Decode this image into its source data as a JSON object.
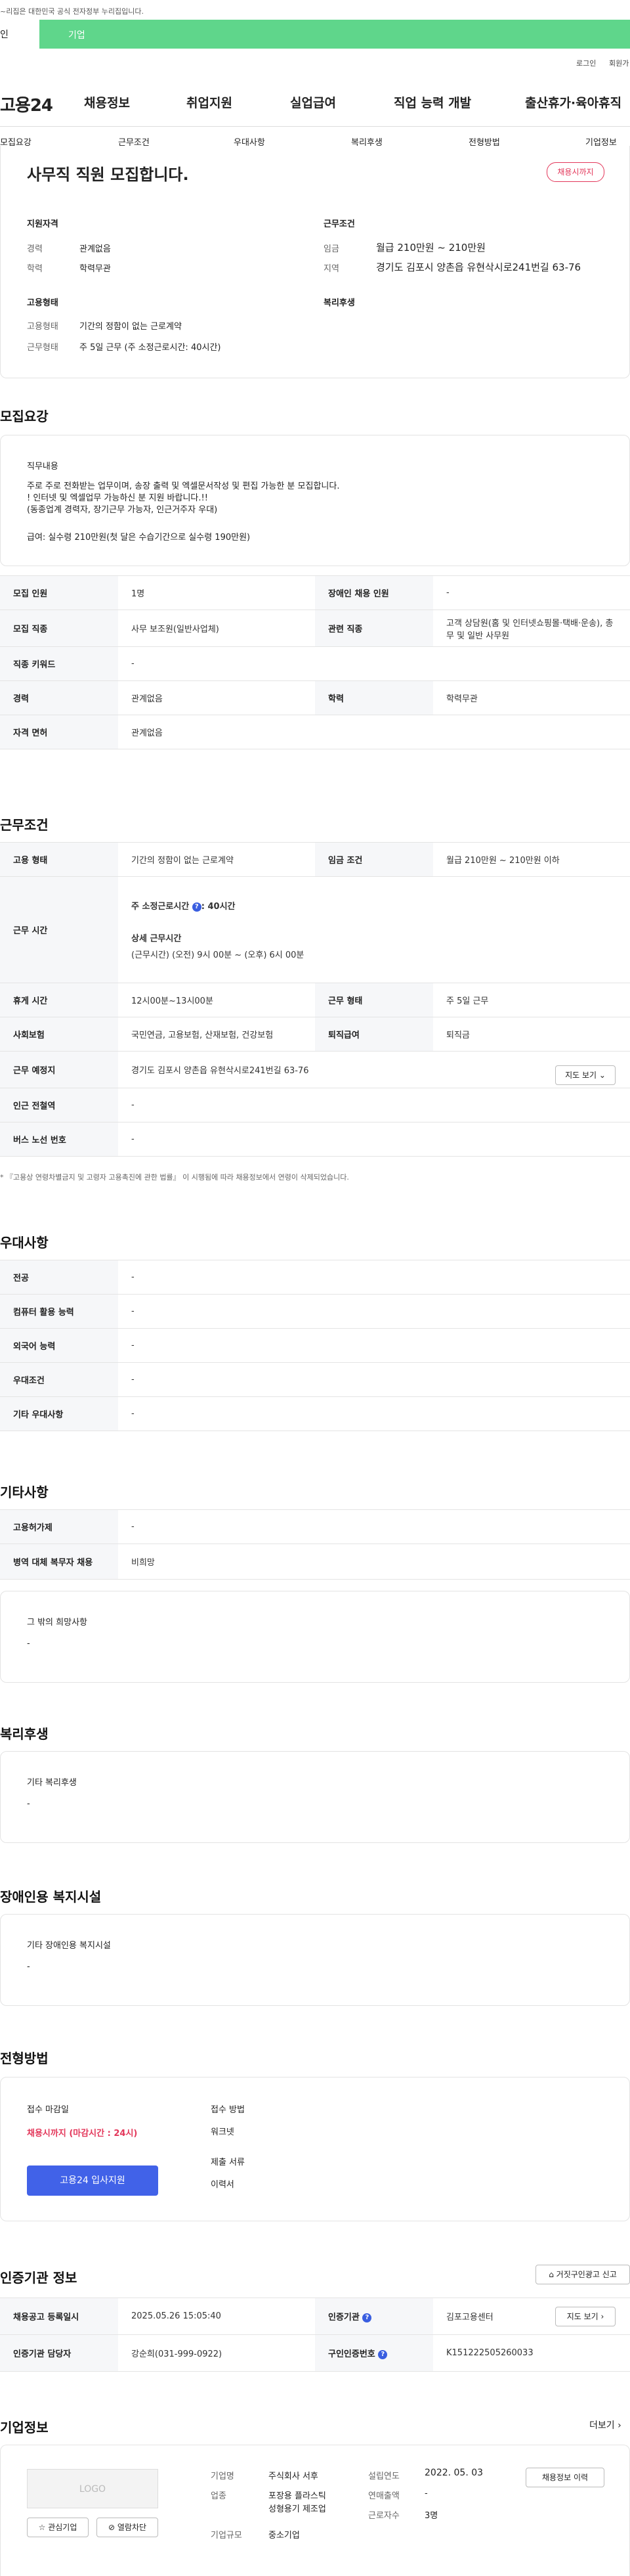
{
  "gov_notice": "~리집은 대한민국 공식 전자정부 누리집입니다.",
  "top_tabs": [
    "인",
    "기업"
  ],
  "util": {
    "login": "로그인",
    "join": "회원가"
  },
  "gnb": {
    "logo": "고용24",
    "items": [
      "채용정보",
      "취업지원",
      "실업급여",
      "직업 능력 개발",
      "출산휴가·육아휴직"
    ]
  },
  "anchor": [
    "모집요강",
    "근무조건",
    "우대사항",
    "복리후생",
    "전형방법",
    "기업정보"
  ],
  "summary": {
    "title": "사무직 직원 모집합니다.",
    "badge": "채용시까지",
    "qual_h": "지원자격",
    "career_l": "경력",
    "career_v": "관계없음",
    "edu_l": "학력",
    "edu_v": "학력무관",
    "cond_h": "근무조건",
    "wage_l": "임금",
    "wage_v": "월급 210만원 ~ 210만원",
    "area_l": "지역",
    "area_v": "경기도 김포시 양촌읍 유현삭시로241번길 63-76",
    "emp_h": "고용형태",
    "type_l": "고용형태",
    "type_v": "기간의 정함이 없는 근로계약",
    "work_l": "근무형태",
    "work_v": "주 5일 근무 (주 소정근로시간: 40시간)",
    "welfare_h": "복리후생"
  },
  "recruit": {
    "h": "모집요강",
    "duty_h": "직무내용",
    "duty_1": "주로 주로 전화받는 업무이며, 송장 출력 및 엑셀문서작성 및 편집 가능한 분 모집합니다.",
    "duty_2": "! 인터넷 및 엑셀업무 가능하신 분 지원 바랍니다.!!",
    "duty_3": "(동종업계 경력자, 장기근무 가능자, 인근거주자 우대)",
    "duty_4": "급여: 실수령 210만원(첫 달은 수습기간으로 실수령 190만원)",
    "rows": [
      [
        "모집 인원",
        "1명",
        "장애인 채용 인원",
        "-"
      ],
      [
        "모집 직종",
        "사무 보조원(일반사업체)",
        "관련 직종",
        "고객 상담원(홈 및 인터넷쇼핑몰·택배·운송), 총무 및 일반 사무원"
      ],
      [
        "직종 키워드",
        "-"
      ],
      [
        "경력",
        "관계없음",
        "학력",
        "학력무관"
      ],
      [
        "자격 면허",
        "관계없음"
      ]
    ]
  },
  "work": {
    "h": "근무조건",
    "type_l": "고용 형태",
    "type_v": "기간의 정함이 없는 근로계약",
    "wage_l": "임금 조건",
    "wage_v": "월급 210만원 ~ 210만원 이하",
    "hours_l": "근무 시간",
    "hours_1": "주 소정근로시간",
    "hours_2": ": 40시간",
    "hours_3": "상세 근무시간",
    "hours_4": "(근무시간) (오전) 9시 00분 ~ (오후) 6시 00분",
    "rest_l": "휴게 시간",
    "rest_v": "12시00분~13시00분",
    "form_l": "근무 형태",
    "form_v": "주 5일 근무",
    "ins_l": "사회보험",
    "ins_v": "국민연금, 고용보험, 산재보험, 건강보험",
    "ret_l": "퇴직급여",
    "ret_v": "퇴직금",
    "place_l": "근무 예정지",
    "place_v": "경기도 김포시 양촌읍 유현삭시로241번길 63-76",
    "map_btn": "지도 보기",
    "sta_l": "인근 전철역",
    "sta_v": "-",
    "bus_l": "버스 노선 번호",
    "bus_v": "-",
    "note": "* 『고용상 연령차별금지 및 고령자 고용촉진에 관한 법률』 이 시행됨에 따라 채용정보에서 연령이 삭제되었습니다."
  },
  "pref": {
    "h": "우대사항",
    "rows": [
      [
        "전공",
        "-"
      ],
      [
        "컴퓨터 활용 능력",
        "-"
      ],
      [
        "외국어 능력",
        "-"
      ],
      [
        "우대조건",
        "-"
      ],
      [
        "기타 우대사항",
        "-"
      ]
    ]
  },
  "etc": {
    "h": "기타사항",
    "rows": [
      [
        "고용허가제",
        "-"
      ],
      [
        "병역 대체 복무자 채용",
        "비희망"
      ]
    ],
    "other_h": "그 밖의 희망사항",
    "other_v": "-"
  },
  "welfare": {
    "h": "복리후생",
    "sub": "기타 복리후생",
    "v": "-"
  },
  "disabled": {
    "h": "장애인용 복지시설",
    "sub": "기타 장애인용 복지시설",
    "v": "-"
  },
  "process": {
    "h": "전형방법",
    "close_l": "접수 마감일",
    "close_v": "채용시까지 (마감시간 : 24시)",
    "apply_btn": "고용24 입사지원",
    "method_l": "접수 방법",
    "method_v": "워크넷",
    "docs_l": "제출 서류",
    "docs_v": "이력서"
  },
  "agency": {
    "h": "인증기관 정보",
    "report_btn": "거짓구인광고 신고",
    "reg_l": "채용공고 등록일시",
    "reg_v": "2025.05.26 15:05:40",
    "ag_l": "인증기관",
    "ag_v": "김포고용센터",
    "map_btn": "지도 보기",
    "mgr_l": "인증기관 담당자",
    "mgr_v": "강순희(031-999-0922)",
    "no_l": "구인인증번호",
    "no_v": "K151222505260033"
  },
  "company": {
    "h": "기업정보",
    "more": "더보기",
    "logo": "LOGO",
    "fav_btn": "관심기업",
    "block_btn": "열람차단",
    "name_l": "기업명",
    "name_v": "주식회사 서후",
    "ind_l": "업종",
    "ind_v1": "포장용 플라스틱",
    "ind_v2": "성형용기 제조업",
    "size_l": "기업규모",
    "size_v": "중소기업",
    "est_l": "설립연도",
    "est_v": "2022. 05. 03",
    "sales_l": "연매출액",
    "sales_v": "-",
    "emp_l": "근로자수",
    "emp_v": "3명",
    "hist_btn": "채용정보 이력"
  }
}
